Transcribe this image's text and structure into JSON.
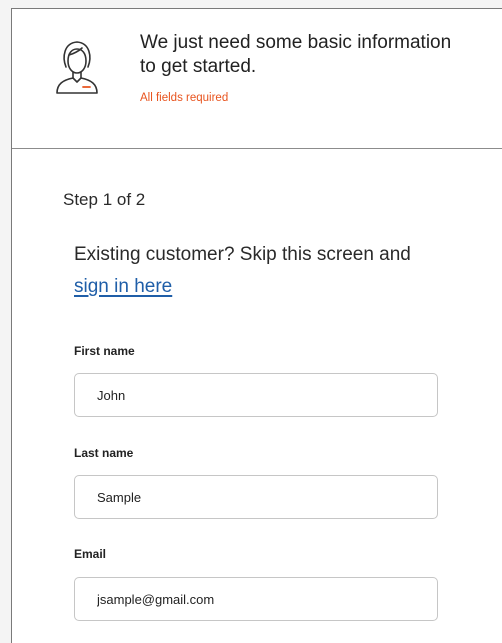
{
  "header": {
    "title": "We just need some basic information to get started.",
    "subtitle": "All fields required",
    "accent_color": "#e8541f",
    "icon": "user-avatar-icon"
  },
  "form": {
    "step_text": "Step 1 of 2",
    "intro_text": "Existing customer? Skip this screen and",
    "sign_in_link": "sign in here",
    "link_color": "#1f5ea8",
    "fields": [
      {
        "label": "First name",
        "value": "John"
      },
      {
        "label": "Last name",
        "value": "Sample"
      },
      {
        "label": "Email",
        "value": "jsample@gmail.com"
      }
    ]
  }
}
